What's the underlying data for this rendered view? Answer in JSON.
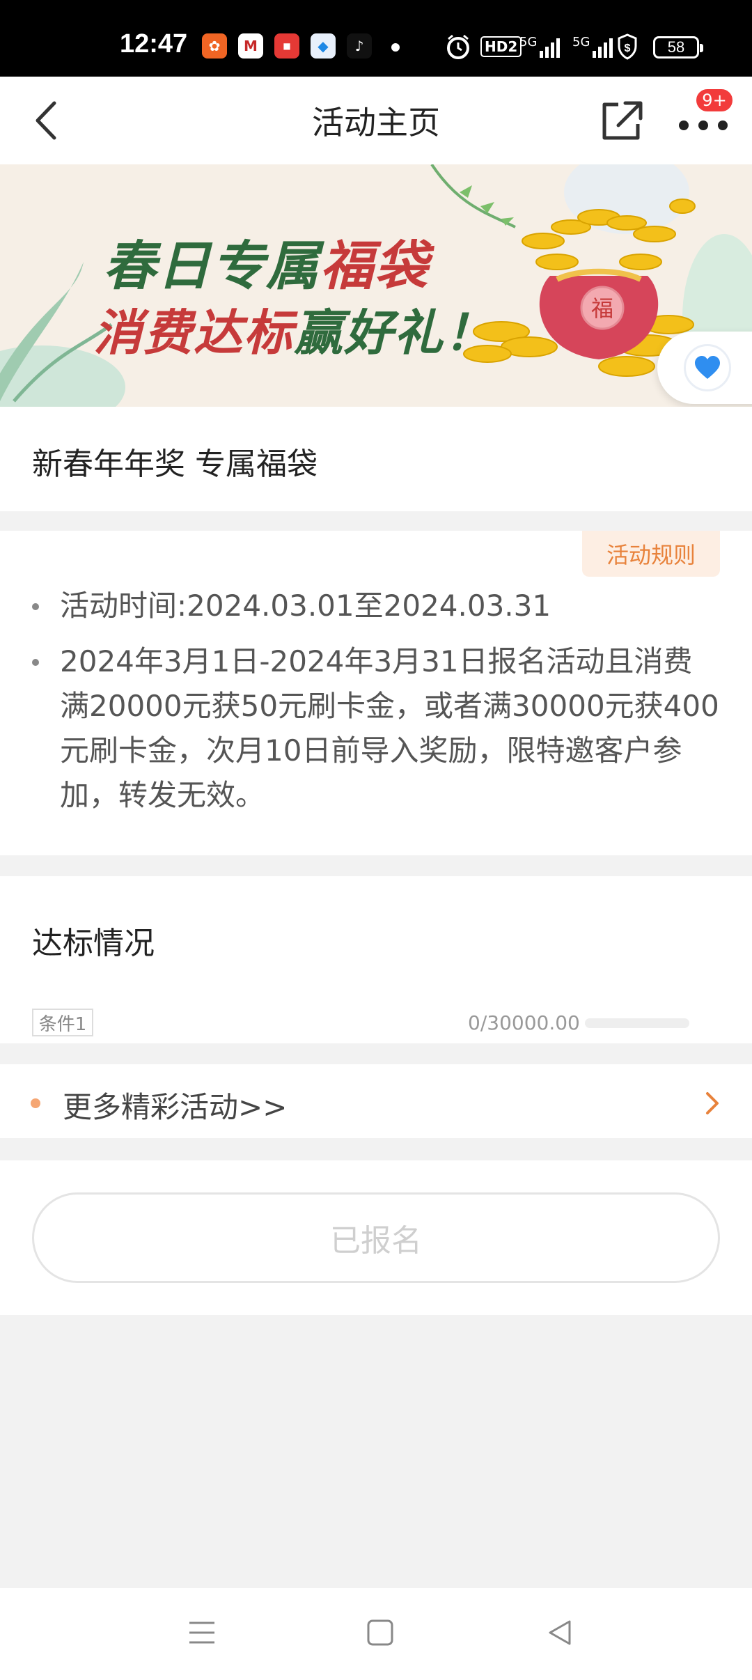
{
  "status_bar": {
    "time": "12:47",
    "hd_label": "HD2",
    "net1": "5G",
    "net2": "5G",
    "battery": "58"
  },
  "nav": {
    "title": "活动主页",
    "badge": "9+"
  },
  "banner": {
    "line1_a": "春日专属",
    "line1_b": "福袋",
    "line2_a": "消费达标",
    "line2_b": "赢好礼！",
    "bag_char": "福"
  },
  "activity": {
    "subtitle": "新春年年奖 专属福袋",
    "rules_button": "活动规则",
    "bullets": [
      "活动时间:2024.03.01至2024.03.31",
      "2024年3月1日-2024年3月31日报名活动且消费满20000元获50元刷卡金，或者满30000元获400元刷卡金，次月10日前导入奖励，限特邀客户参加，转发无效。"
    ]
  },
  "progress": {
    "title": "达标情况",
    "condition_tag": "条件1",
    "progress_text": "0/30000.00",
    "progress_fraction": 0
  },
  "more": {
    "label": "更多精彩活动>>"
  },
  "signup": {
    "label": "已报名"
  },
  "colors": {
    "accent_orange": "#e8823b",
    "banner_green": "#2f6b3d",
    "banner_red": "#c63a3a",
    "badge_red": "#f23b3b"
  }
}
